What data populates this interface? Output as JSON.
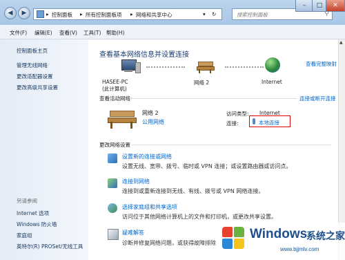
{
  "address": {
    "crumbs": [
      "控制面板",
      "所有控制面板项",
      "网络和共享中心"
    ]
  },
  "search": {
    "placeholder": "搜索控制面板"
  },
  "window_buttons": [
    "–",
    "□",
    "✕"
  ],
  "menu": [
    "文件(F)",
    "编辑(E)",
    "查看(V)",
    "工具(T)",
    "帮助(H)"
  ],
  "sidebar": {
    "home": "控制面板主页",
    "links": [
      "管理无线网络",
      "更改适配器设置",
      "更改高级共享设置"
    ],
    "see_also_title": "另请参阅",
    "see_also": [
      "Internet 选项",
      "Windows 防火墙",
      "家庭组",
      "英特尔(R) PROSet/无线工具"
    ]
  },
  "main": {
    "title": "查看基本网络信息并设置连接",
    "full_map": "查看完整映射",
    "map": {
      "pc_name": "HASEE-PC",
      "pc_sub": "(此计算机)",
      "network": "网络  2",
      "internet": "Internet"
    },
    "active": {
      "title": "查看活动网络",
      "connect_disconnect": "连接或断开连接",
      "network_name": "网络  2",
      "network_type": "公用网络",
      "access_label": "访问类型:",
      "access_value": "Internet",
      "conn_label": "连接:",
      "conn_value": "本地连接"
    },
    "change": {
      "title": "更改网络设置",
      "tasks": [
        {
          "link": "设置新的连接或网络",
          "desc": "设置无线、宽带、拨号、临时或 VPN 连接；或设置路由器或访问点。"
        },
        {
          "link": "连接到网络",
          "desc": "连接到或重新连接到无线、有线、拨号或 VPN 网络连接。"
        },
        {
          "link": "选择家庭组和共享选项",
          "desc": "访问位于其他网络计算机上的文件和打印机，或更改共享设置。"
        },
        {
          "link": "疑难解答",
          "desc": "诊断并修复网络问题，或获得故障排除"
        }
      ]
    }
  },
  "watermark": {
    "brand": "Windows",
    "suffix": "系统之家",
    "url": "www.bjjmlv.com"
  },
  "colors": {
    "link": "#0066cc",
    "title": "#1a3e6e",
    "highlight": "#e00000"
  }
}
